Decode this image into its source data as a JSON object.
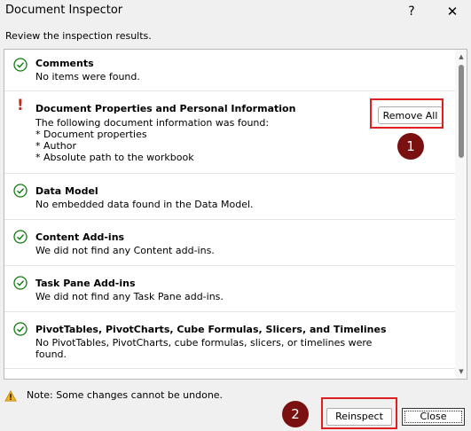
{
  "window": {
    "title": "Document Inspector",
    "help": "?",
    "close": "✕"
  },
  "instruction": "Review the inspection results.",
  "results": [
    {
      "status": "ok",
      "title": "Comments",
      "lines": [
        "No items were found."
      ]
    },
    {
      "status": "issue",
      "title": "Document Properties and Personal Information",
      "lines": [
        "The following document information was found:",
        "* Document properties",
        "* Author",
        "* Absolute path to the workbook"
      ],
      "action": "Remove All"
    },
    {
      "status": "ok",
      "title": "Data Model",
      "lines": [
        "No embedded data found in the Data Model."
      ]
    },
    {
      "status": "ok",
      "title": "Content Add-ins",
      "lines": [
        "We did not find any Content add-ins."
      ]
    },
    {
      "status": "ok",
      "title": "Task Pane Add-ins",
      "lines": [
        "We did not find any Task Pane add-ins."
      ]
    },
    {
      "status": "ok",
      "title": "PivotTables, PivotCharts, Cube Formulas, Slicers, and Timelines",
      "lines": [
        "No PivotTables, PivotCharts, cube formulas, slicers, or timelines were",
        "found."
      ]
    }
  ],
  "annotations": {
    "step1": "1",
    "step2": "2"
  },
  "note": "Note: Some changes cannot be undone.",
  "buttons": {
    "reinspect": "Reinspect",
    "close": "Close"
  },
  "colors": {
    "ok": "#107c10",
    "issue": "#c42b1c",
    "highlight": "#e02020",
    "badge": "#7a1010"
  }
}
